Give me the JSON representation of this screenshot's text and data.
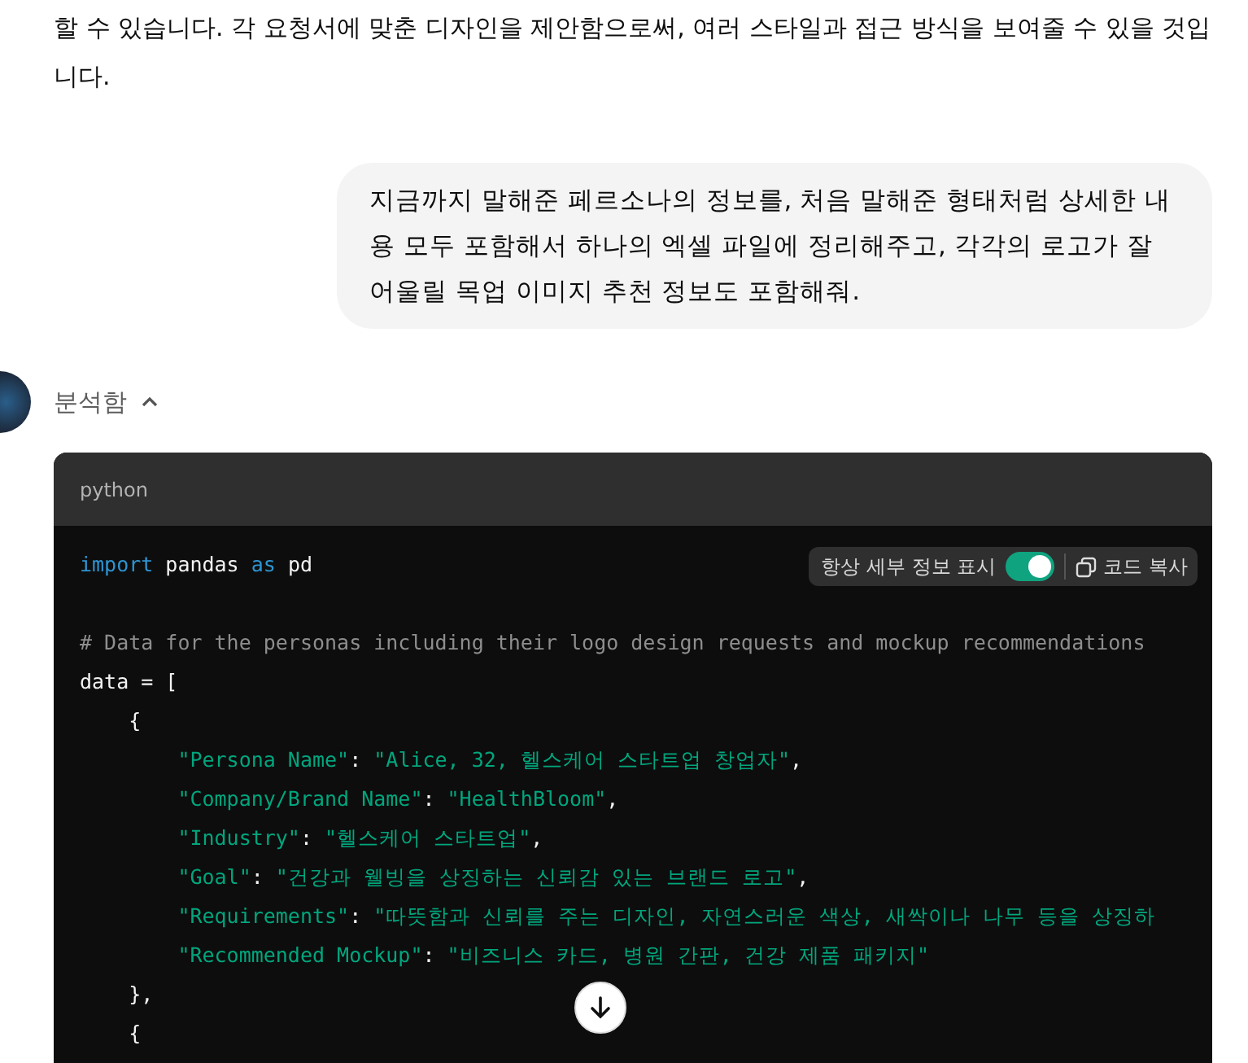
{
  "assistant_intro": {
    "text": "할 수 있습니다. 각 요청서에 맞춘 디자인을 제안함으로써, 여러 스타일과 접근 방식을 보여줄 수 있을 것입니다."
  },
  "user_message": {
    "text": "지금까지 말해준 페르소나의 정보를, 처음 말해준 형태처럼 상세한 내용 모두 포함해서 하나의 엑셀 파일에 정리해주고, 각각의 로고가 잘 어울릴 목업 이미지 추천 정보도 포함해줘."
  },
  "analysis": {
    "label": "분석함",
    "expanded": true
  },
  "code_block": {
    "language": "python",
    "details_toggle": {
      "label": "항상 세부 정보 표시",
      "on": true
    },
    "copy_label": "코드 복사",
    "lines": [
      {
        "gap_before": false,
        "tokens": [
          {
            "kind": "keyword",
            "text": "import"
          },
          {
            "kind": "plain",
            "text": " pandas "
          },
          {
            "kind": "keyword",
            "text": "as"
          },
          {
            "kind": "plain",
            "text": " pd"
          }
        ]
      },
      {
        "gap_before": true,
        "tokens": [
          {
            "kind": "comment",
            "text": "# Data for the personas including their logo design requests and mockup recommendations"
          }
        ]
      },
      {
        "gap_before": false,
        "tokens": [
          {
            "kind": "plain",
            "text": "data = ["
          }
        ]
      },
      {
        "gap_before": false,
        "tokens": [
          {
            "kind": "plain",
            "text": "    {"
          }
        ]
      },
      {
        "gap_before": false,
        "tokens": [
          {
            "kind": "string",
            "text": "        \"Persona Name\""
          },
          {
            "kind": "plain",
            "text": ": "
          },
          {
            "kind": "string",
            "text": "\"Alice, 32, 헬스케어 스타트업 창업자\""
          },
          {
            "kind": "plain",
            "text": ","
          }
        ]
      },
      {
        "gap_before": false,
        "tokens": [
          {
            "kind": "string",
            "text": "        \"Company/Brand Name\""
          },
          {
            "kind": "plain",
            "text": ": "
          },
          {
            "kind": "string",
            "text": "\"HealthBloom\""
          },
          {
            "kind": "plain",
            "text": ","
          }
        ]
      },
      {
        "gap_before": false,
        "tokens": [
          {
            "kind": "string",
            "text": "        \"Industry\""
          },
          {
            "kind": "plain",
            "text": ": "
          },
          {
            "kind": "string",
            "text": "\"헬스케어 스타트업\""
          },
          {
            "kind": "plain",
            "text": ","
          }
        ]
      },
      {
        "gap_before": false,
        "tokens": [
          {
            "kind": "string",
            "text": "        \"Goal\""
          },
          {
            "kind": "plain",
            "text": ": "
          },
          {
            "kind": "string",
            "text": "\"건강과 웰빙을 상징하는 신뢰감 있는 브랜드 로고\""
          },
          {
            "kind": "plain",
            "text": ","
          }
        ]
      },
      {
        "gap_before": false,
        "tokens": [
          {
            "kind": "string",
            "text": "        \"Requirements\""
          },
          {
            "kind": "plain",
            "text": ": "
          },
          {
            "kind": "string",
            "text": "\"따뜻함과 신뢰를 주는 디자인, 자연스러운 색상, 새싹이나 나무 등을 상징하"
          }
        ]
      },
      {
        "gap_before": false,
        "tokens": [
          {
            "kind": "string",
            "text": "        \"Recommended Mockup\""
          },
          {
            "kind": "plain",
            "text": ": "
          },
          {
            "kind": "string",
            "text": "\"비즈니스 카드, 병원 간판, 건강 제품 패키지\""
          }
        ]
      },
      {
        "gap_before": false,
        "tokens": [
          {
            "kind": "plain",
            "text": "    },"
          }
        ]
      },
      {
        "gap_before": false,
        "tokens": [
          {
            "kind": "plain",
            "text": "    {"
          }
        ]
      }
    ]
  }
}
